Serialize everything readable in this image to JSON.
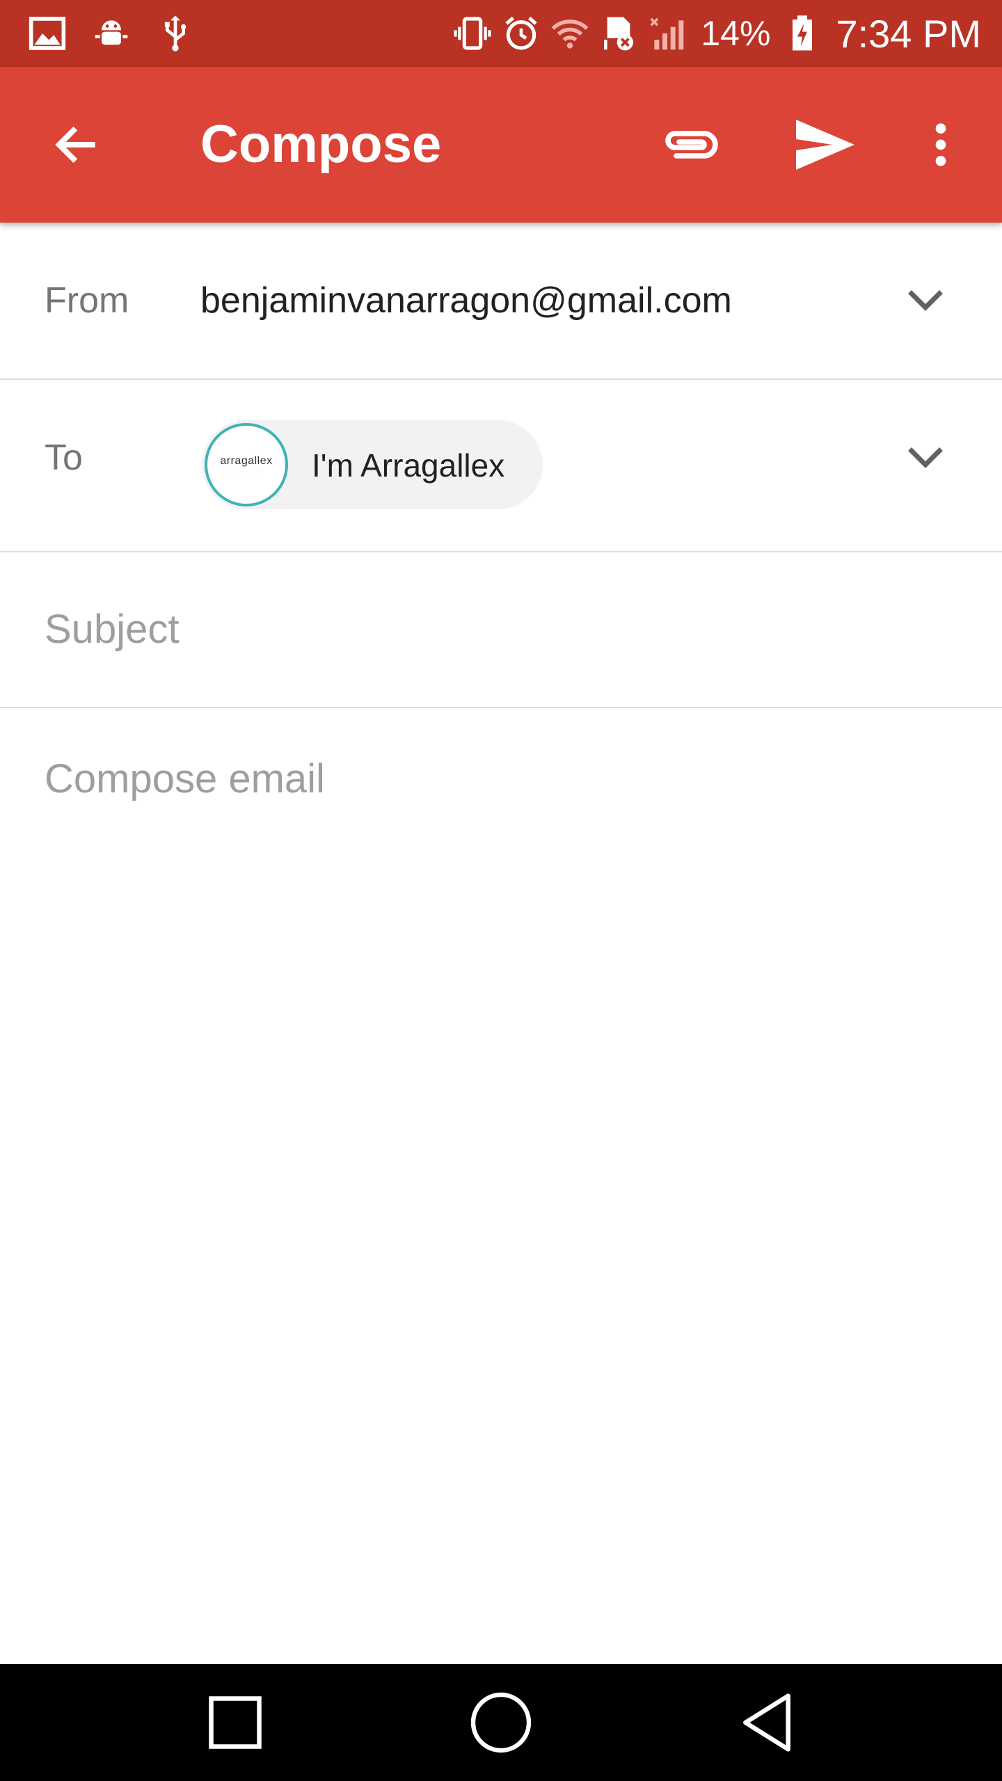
{
  "status_bar": {
    "battery_percent": "14%",
    "time": "7:34 PM",
    "left_icons": [
      "gallery-icon",
      "android-debug-icon",
      "usb-icon"
    ],
    "right_icons": [
      "vibrate-icon",
      "alarm-icon",
      "wifi-icon",
      "sd-card-error-icon",
      "signal-icon",
      "battery-charging-icon"
    ]
  },
  "app_bar": {
    "title": "Compose",
    "color": "#db4437",
    "actions": [
      "attach-icon",
      "send-icon",
      "more-vert-icon"
    ]
  },
  "form": {
    "from_label": "From",
    "from_value": "benjaminvanarragon@gmail.com",
    "to_label": "To",
    "to_chip": {
      "name": "I'm Arragallex",
      "avatar_text": "arragallex",
      "avatar_ring_color": "#3fb3b5"
    },
    "subject_placeholder": "Subject",
    "body_placeholder": "Compose email"
  },
  "nav_bar": {
    "buttons": [
      "recents-icon",
      "home-icon",
      "back-icon"
    ]
  }
}
